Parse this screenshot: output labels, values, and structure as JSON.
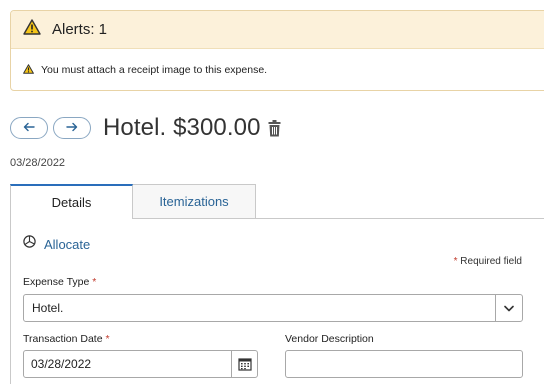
{
  "alert": {
    "title": "Alerts: 1",
    "message": "You must attach a receipt image to this expense."
  },
  "header": {
    "prev_icon": "arrow-left-icon",
    "next_icon": "arrow-right-icon",
    "title": "Hotel. $300.00",
    "delete_icon": "trash-icon",
    "date": "03/28/2022"
  },
  "tabs": [
    {
      "label": "Details",
      "active": true
    },
    {
      "label": "Itemizations",
      "active": false
    }
  ],
  "form": {
    "allocate_label": "Allocate",
    "required_note": "Required field",
    "required_marker": "*",
    "expense_type": {
      "label": "Expense Type",
      "value": "Hotel."
    },
    "transaction_date": {
      "label": "Transaction Date",
      "value": "03/28/2022"
    },
    "vendor_description": {
      "label": "Vendor Description",
      "value": ""
    }
  },
  "colors": {
    "accent": "#2a6496",
    "alert_bg": "#fcf1da",
    "required": "#c0392b",
    "warning_icon": "#f5c518"
  }
}
